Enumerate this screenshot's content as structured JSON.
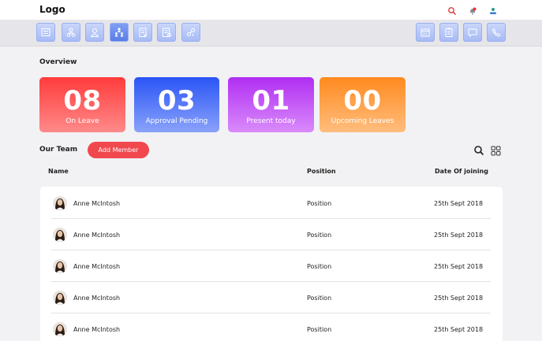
{
  "header": {
    "logo": "Logo",
    "icons": [
      "search-icon",
      "notification-icon",
      "profile-icon"
    ]
  },
  "toolbar": {
    "left_tools": [
      "list-icon",
      "org-chart-icon",
      "user-icon",
      "team-icon",
      "document-icon",
      "checklist-icon",
      "skills-icon"
    ],
    "right_tools": [
      "calendar-icon",
      "clipboard-icon",
      "chat-icon",
      "phone-icon"
    ],
    "active": "team-icon"
  },
  "overview": {
    "title": "Overview",
    "cards": [
      {
        "value": "08",
        "label": "On Leave",
        "color_from": "#ff3b3b",
        "color_to": "#ff8a8a"
      },
      {
        "value": "03",
        "label": "Approval Pending",
        "color_from": "#2a55f5",
        "color_to": "#8aa2fb"
      },
      {
        "value": "01",
        "label": "Present today",
        "color_from": "#b12ef2",
        "color_to": "#d98bfb"
      },
      {
        "value": "00",
        "label": "Upcoming Leaves",
        "color_from": "#ff8a1f",
        "color_to": "#ffbd7d"
      }
    ]
  },
  "team": {
    "title": "Our Team",
    "add_button": "Add Member",
    "columns": {
      "name": "Name",
      "position": "Position",
      "date": "Date Of joining"
    },
    "rows": [
      {
        "name": "Anne McIntosh",
        "position": "Position",
        "date": "25th Sept 2018"
      },
      {
        "name": "Anne McIntosh",
        "position": "Position",
        "date": "25th Sept 2018"
      },
      {
        "name": "Anne McIntosh",
        "position": "Position",
        "date": "25th Sept 2018"
      },
      {
        "name": "Anne McIntosh",
        "position": "Position",
        "date": "25th Sept 2018"
      },
      {
        "name": "Anne McIntosh",
        "position": "Position",
        "date": "25th Sept 2018"
      }
    ]
  },
  "colors": {
    "accent": "#f0484d",
    "toolbar_icon": "#a7bbf5",
    "toolbar_icon_active": "#5b7ee8"
  }
}
